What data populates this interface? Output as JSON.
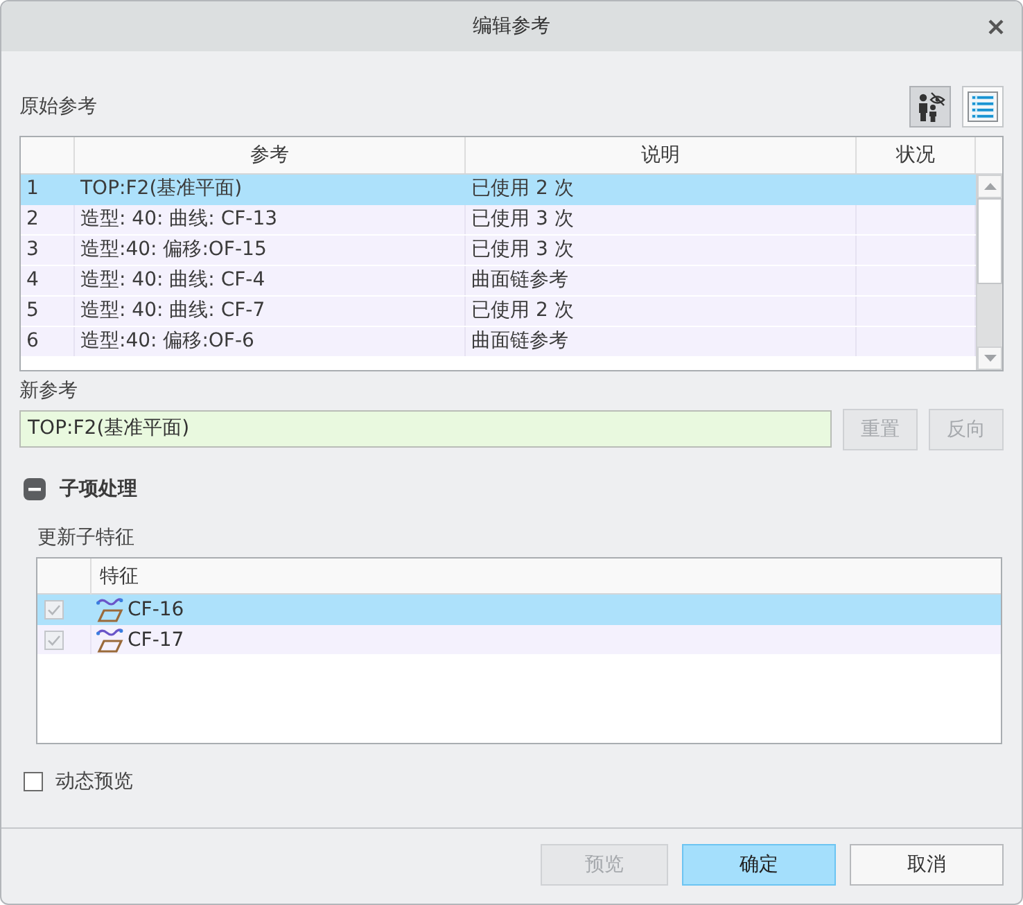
{
  "window": {
    "title": "编辑参考"
  },
  "original_references": {
    "label": "原始参考",
    "tools": [
      {
        "kind": "visibility",
        "selected": true
      },
      {
        "kind": "list",
        "selected": false
      }
    ],
    "table": {
      "columns": [
        "参考",
        "说明",
        "状况"
      ],
      "rows": [
        {
          "index": "1",
          "reference": "TOP:F2(基准平面)",
          "description": "已使用 2 次",
          "selected": true
        },
        {
          "index": "2",
          "reference": "造型: 40: 曲线: CF-13",
          "description": "已使用 3 次",
          "selected": false
        },
        {
          "index": "3",
          "reference": "造型:40: 偏移:OF-15",
          "description": "已使用 3 次",
          "selected": false
        },
        {
          "index": "4",
          "reference": "造型: 40: 曲线: CF-4",
          "description": "曲面链参考",
          "selected": false
        },
        {
          "index": "5",
          "reference": "造型: 40: 曲线: CF-7",
          "description": "已使用 2 次",
          "selected": false
        },
        {
          "index": "6",
          "reference": "造型:40: 偏移:OF-6",
          "description": "曲面链参考",
          "selected": false
        }
      ]
    }
  },
  "new_reference": {
    "label": "新参考",
    "value": "TOP:F2(基准平面)",
    "buttons": [
      {
        "label": "重置",
        "disabled": true
      },
      {
        "label": "反向",
        "disabled": true
      }
    ]
  },
  "child_handling": {
    "title": "子项处理",
    "expanded": true,
    "subtitle": "更新子特征",
    "table": {
      "columns": [
        "特征"
      ],
      "rows": [
        {
          "name": "CF-16",
          "checked": true,
          "disabled": true,
          "selected": true
        },
        {
          "name": "CF-17",
          "checked": true,
          "disabled": true,
          "selected": false
        }
      ]
    }
  },
  "dynamic_preview": {
    "label": "动态预览",
    "checked": false
  },
  "buttons": [
    {
      "label": "预览",
      "disabled": true,
      "primary": false
    },
    {
      "label": "确定",
      "disabled": false,
      "primary": true
    },
    {
      "label": "取消",
      "disabled": false,
      "primary": false
    }
  ]
}
